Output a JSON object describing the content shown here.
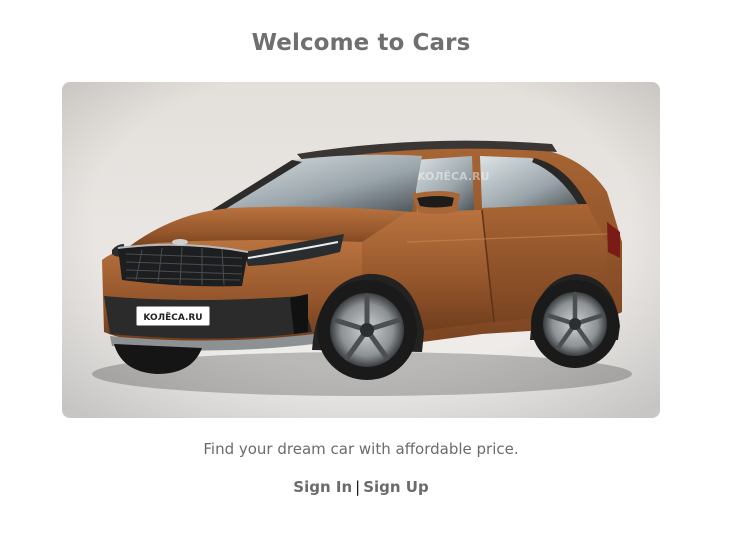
{
  "page": {
    "title": "Welcome to Cars",
    "tagline": "Find your dream car with affordable price.",
    "hero_image": {
      "plate_text": "KOЛЁCA.RU",
      "watermark_text": "KOЛЁCA.RU"
    }
  },
  "auth": {
    "sign_in_label": "Sign In",
    "separator": "|",
    "sign_up_label": "Sign Up"
  },
  "colors": {
    "car_body": "#9a5a2e",
    "text": "#6b6b6b"
  }
}
